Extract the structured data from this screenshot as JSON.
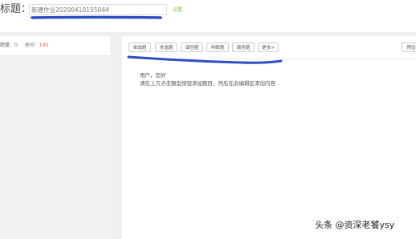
{
  "header": {
    "title_label": "标题：",
    "title_value": "新建作业20200410155044",
    "set_link": "设置"
  },
  "sidebar": {
    "count_label": "题量：",
    "count_value": "0",
    "score_label": "总分：",
    "score_value": "100"
  },
  "toolbar": {
    "buttons": [
      "单选题",
      "多选题",
      "填空题",
      "判断题",
      "简答题",
      "更多>"
    ],
    "right_button": "预览"
  },
  "content": {
    "greeting": "用户，您好",
    "instruction": "请在上方点击题型按钮添加题目，然后在此编辑区添加内容"
  },
  "watermark": {
    "text": "头条 @资深老饕ysy"
  },
  "colors": {
    "annotation_stroke": "#2f4fc4",
    "score_value": "#e05050",
    "set_link": "#7bbf3a"
  }
}
